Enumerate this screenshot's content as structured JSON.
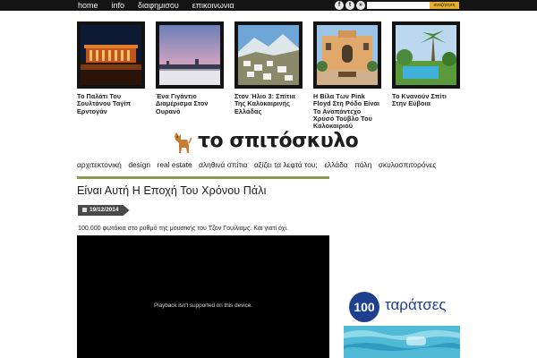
{
  "top_nav": {
    "items": [
      "home",
      "info",
      "διαφημισου",
      "επικοινωνια"
    ]
  },
  "social": {
    "icons": [
      "facebook-icon",
      "twitter-icon",
      "rss-icon"
    ],
    "glyphs": [
      "f",
      "t",
      "»"
    ]
  },
  "search": {
    "value": "",
    "placeholder": "",
    "button_label": "αναζήτηση"
  },
  "featured": [
    {
      "caption": "Το Παλάτι Του Σουλτάνου Ταγίπ Ερντογάν"
    },
    {
      "caption": "Ένα Γιγάντιο Διαμέρισμα Στον Ουρανό"
    },
    {
      "caption": "Στον Ήλιο 3: Σπίτια Της Καλοκαιρινής Ελλάδας"
    },
    {
      "caption": "Η Βίλα Των Pink Floyd Στη Ρόδο Είναι Το Αναπάντεχο Χρυσό Τούβλο Του Καλοκαιριού"
    },
    {
      "caption": "Το Κνανούν Σπίτι Στην Εύβοια"
    }
  ],
  "logo": {
    "text": "το σπιτόσκυλο"
  },
  "categories": [
    "αρχιτεκτονική",
    "design",
    "real estate",
    "αληθινά σπίτια",
    "αξίζει τα λεφτά του;",
    "ελλάδα",
    "πόλη",
    "σκυλοσπιτορόνες"
  ],
  "post": {
    "title": "Είναι Αυτή Η Εποχή Του Χρόνου Πάλι",
    "date": "19/12/2014",
    "excerpt": "100.000 φωτάκια στο ρυθμό της μουσικής του Τζον Γουίλιαμς. Και γιατί όχι.",
    "video_message": "Playback isn't supported on this device."
  },
  "sidebar_ad": {
    "number": "100",
    "text": "ταράτσες"
  },
  "colors": {
    "topbar": "#141414",
    "accent_rule": "#8c9a52",
    "search_button": "#e8b028",
    "ad_blue": "#1e3f8e"
  }
}
